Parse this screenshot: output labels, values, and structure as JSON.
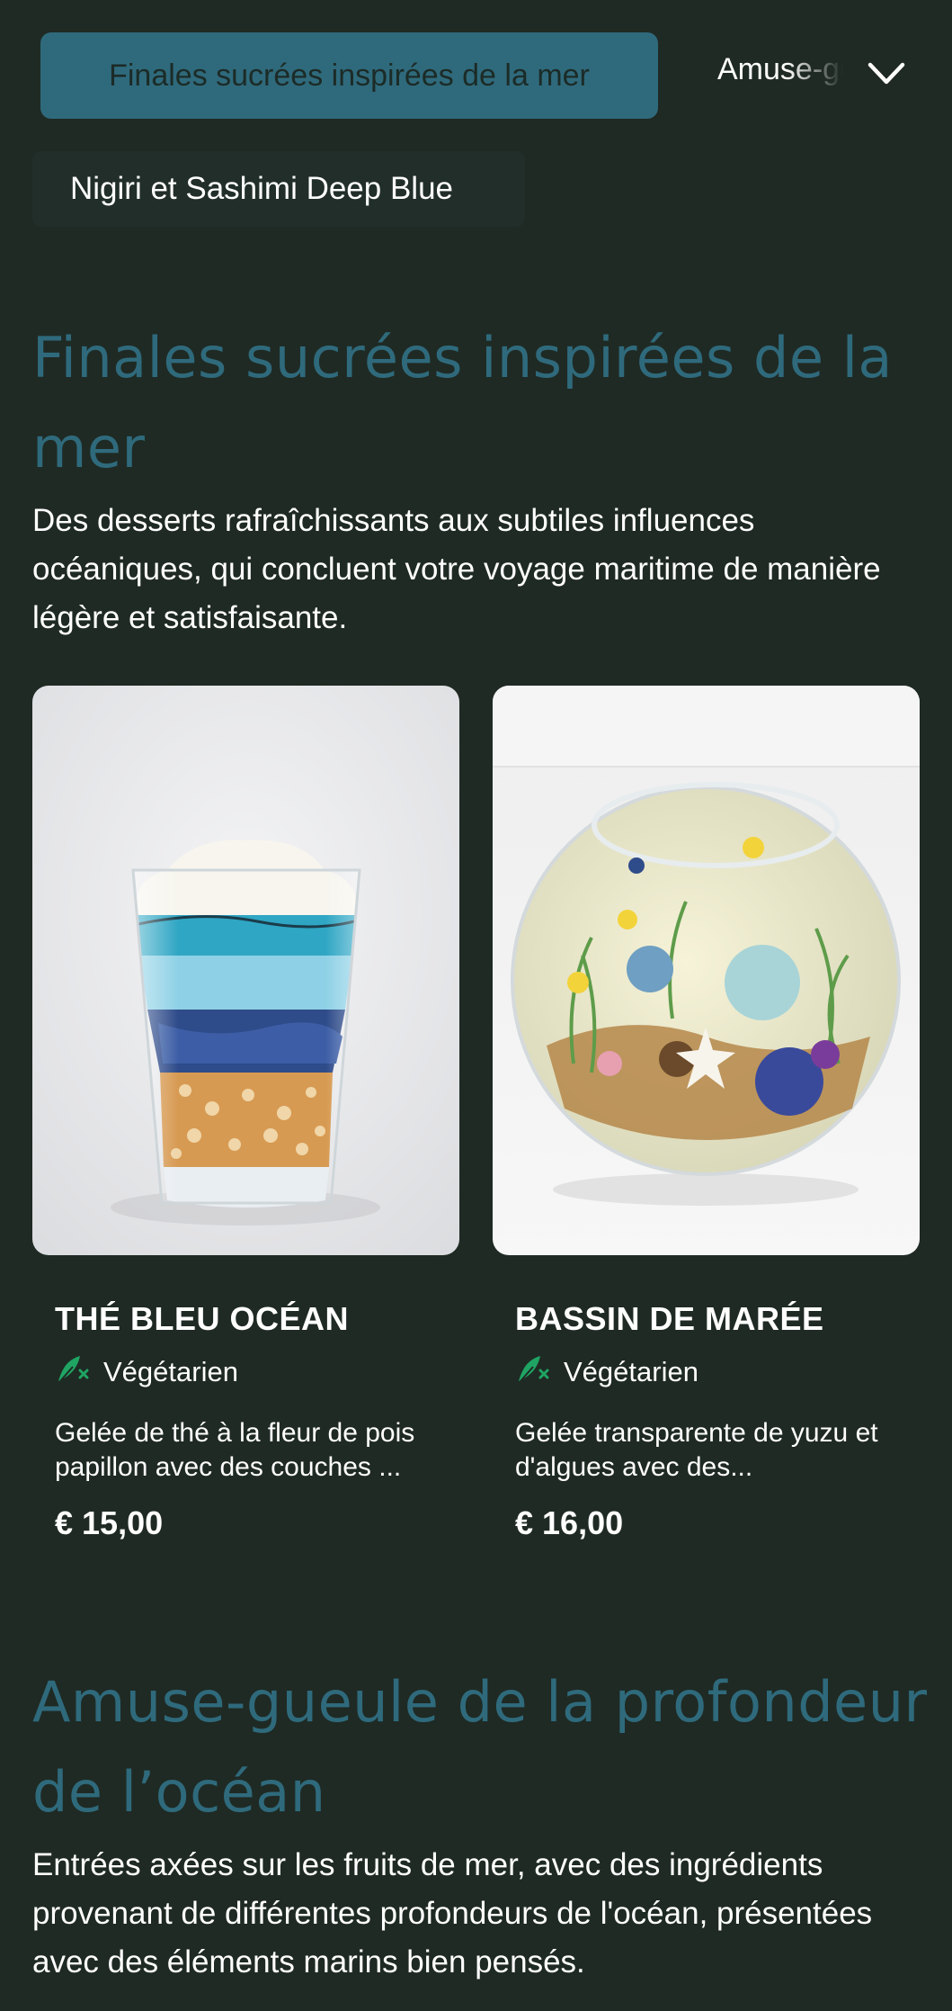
{
  "nav": {
    "active_category": "Finales sucrées inspirées de la mer",
    "next_category": "Amuse-gueule de la profondeur de l’océan",
    "secondary_category": "Nigiri et Sashimi Deep Blue",
    "dropdown_icon": "chevron-down-icon"
  },
  "sections": [
    {
      "title": "Finales sucrées inspirées de la mer",
      "description": "Des desserts rafraîchissants aux subtiles influences océaniques, qui concluent votre voyage maritime de manière légère et satisfaisante.",
      "items": [
        {
          "name": "THÉ BLEU OCÉAN",
          "tag": "Végétarien",
          "tag_icon": "vegetarian-icon",
          "description": "Gelée de thé à la fleur de pois papillon avec des couches ...",
          "price": "€ 15,00"
        },
        {
          "name": "BASSIN DE MARÉE",
          "tag": "Végétarien",
          "tag_icon": "vegetarian-icon",
          "description": "Gelée transparente de yuzu et d'algues avec des...",
          "price": "€ 16,00"
        }
      ]
    },
    {
      "title": "Amuse-gueule de la profondeur de l’océan",
      "description": "Entrées axées sur les fruits de mer, avec des ingrédients provenant de différentes profondeurs de l'océan, présentées avec des éléments marins bien pensés."
    }
  ],
  "colors": {
    "background": "#1f2a24",
    "accent": "#2f6a7c",
    "tag_icon": "#1fa463"
  }
}
